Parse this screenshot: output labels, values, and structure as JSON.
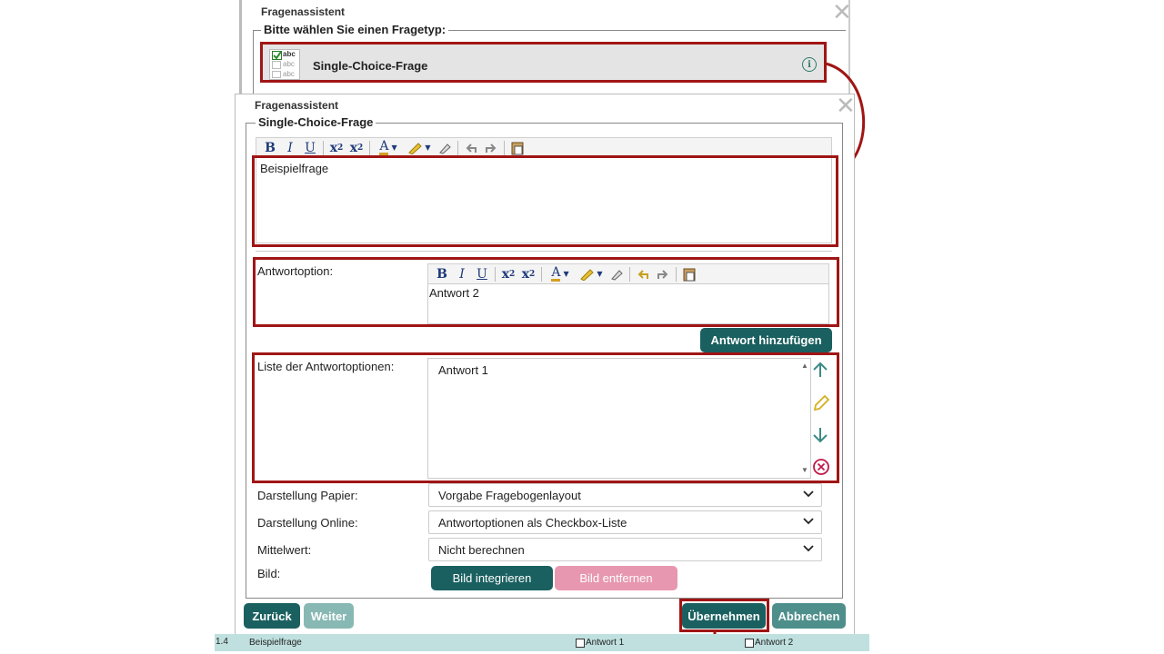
{
  "bg_dialog": {
    "title": "Fragenassistent",
    "legend": "Bitte wählen Sie einen Fragetyp:",
    "question_type": {
      "icon_lines": [
        "abc",
        "abc",
        "abc"
      ],
      "label": "Single-Choice-Frage"
    }
  },
  "dialog": {
    "title": "Fragenassistent",
    "legend": "Single-Choice-Frage",
    "question_text": "Beispielfrage",
    "answer_option": {
      "label": "Antwortoption:",
      "value": "Antwort 2"
    },
    "add_answer_button": "Antwort hinzufügen",
    "answer_list": {
      "label": "Liste der Antwortoptionen:",
      "items": [
        "Antwort 1"
      ]
    },
    "paper_display": {
      "label": "Darstellung Papier:",
      "value": "Vorgabe Fragebogenlayout"
    },
    "online_display": {
      "label": "Darstellung Online:",
      "value": "Antwortoptionen als Checkbox-Liste"
    },
    "mean_value": {
      "label": "Mittelwert:",
      "value": "Nicht berechnen"
    },
    "image": {
      "label": "Bild:",
      "integrate_button": "Bild integrieren",
      "remove_button": "Bild entfernen"
    },
    "footer": {
      "back": "Zurück",
      "next": "Weiter",
      "apply": "Übernehmen",
      "cancel": "Abbrechen"
    }
  },
  "toolbar_icons": [
    "bold-icon",
    "italic-icon",
    "underline-icon",
    "subscript-icon",
    "superscript-icon",
    "text-color-icon",
    "highlight-icon",
    "clear-format-icon",
    "undo-icon",
    "redo-icon",
    "paste-icon"
  ],
  "status_bar": {
    "number": "1.4",
    "question": "Beispielfrage",
    "option1": "Antwort 1",
    "option2": "Antwort 2"
  },
  "colors": {
    "accent_red": "#a01515",
    "teal": "#1b6060",
    "teal_mid": "#4e8f8b",
    "teal_light": "#88b8b3",
    "pink": "#e797b0",
    "status_bg": "#bfe0df"
  }
}
